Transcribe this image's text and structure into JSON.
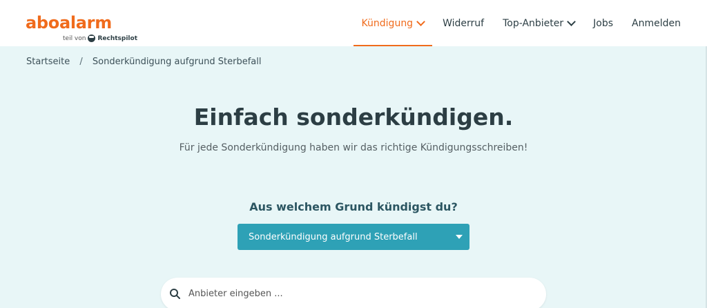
{
  "header": {
    "logo": {
      "main": "aboalarm",
      "sub_prefix": "teil von",
      "sub_brand": "Rechtspilot"
    },
    "nav": [
      {
        "label": "Kündigung",
        "active": true,
        "dropdown": true
      },
      {
        "label": "Widerruf",
        "active": false,
        "dropdown": false
      },
      {
        "label": "Top-Anbieter",
        "active": false,
        "dropdown": true
      },
      {
        "label": "Jobs",
        "active": false,
        "dropdown": false
      },
      {
        "label": "Anmelden",
        "active": false,
        "dropdown": false
      }
    ]
  },
  "breadcrumb": {
    "home": "Startseite",
    "separator": "/",
    "current": "Sonderkündigung aufgrund Sterbefall"
  },
  "hero": {
    "title": "Einfach sonderkündigen.",
    "subtitle": "Für jede Sonderkündigung haben wir das richtige Kündigungsschreiben!"
  },
  "reason": {
    "question": "Aus welchem Grund kündigst du?",
    "selected": "Sonderkündigung aufgrund Sterbefall"
  },
  "search": {
    "placeholder": "Anbieter eingeben ..."
  },
  "colors": {
    "brand_orange": "#f06b1c",
    "accent_teal": "#2ea1b6",
    "page_bg": "#e8f6f7",
    "text_dark": "#2c3e44"
  }
}
